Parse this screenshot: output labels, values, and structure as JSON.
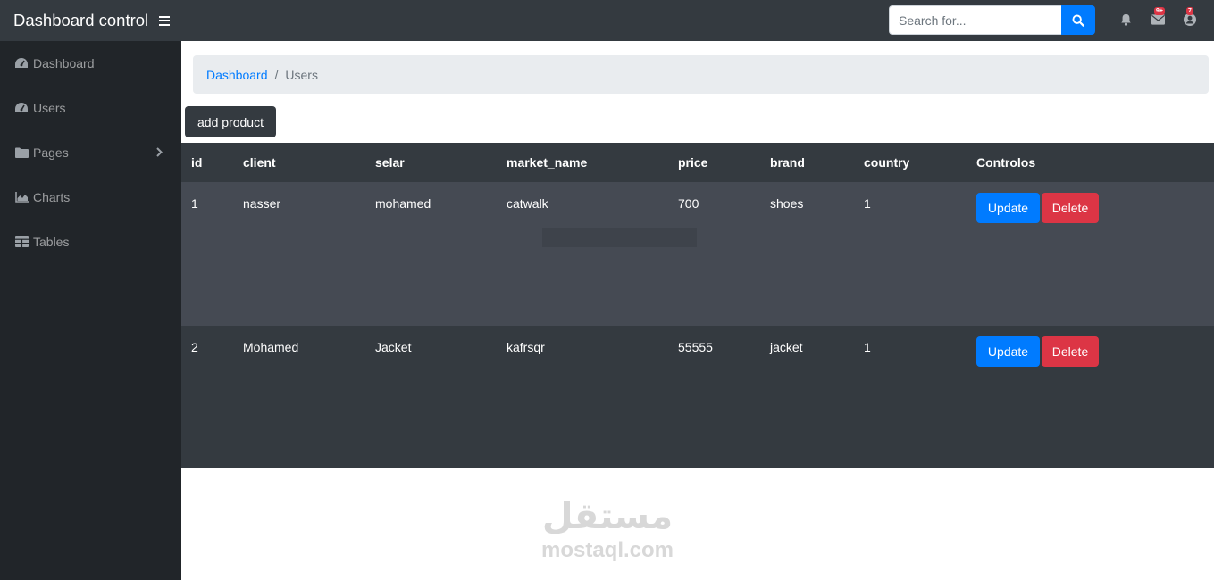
{
  "app": {
    "brand": "Dashboard control",
    "search": {
      "placeholder": "Search for..."
    },
    "badges": {
      "messages": "9+",
      "user": "7"
    }
  },
  "sidebar": {
    "items": [
      {
        "label": "Dashboard",
        "icon": "tachometer-icon"
      },
      {
        "label": "Users",
        "icon": "tachometer-icon"
      },
      {
        "label": "Pages",
        "icon": "folder-icon",
        "has_submenu": true
      },
      {
        "label": "Charts",
        "icon": "area-chart-icon"
      },
      {
        "label": "Tables",
        "icon": "table-icon"
      }
    ]
  },
  "breadcrumb": {
    "link": "Dashboard",
    "separator": "/",
    "current": "Users"
  },
  "toolbar": {
    "add_label": "add product"
  },
  "table": {
    "headers": [
      "id",
      "client",
      "selar",
      "market_name",
      "price",
      "brand",
      "country",
      "Controlos"
    ],
    "rows": [
      {
        "id": "1",
        "client": "nasser",
        "selar": "mohamed",
        "market_name": "catwalk",
        "price": "700",
        "brand": "shoes",
        "country": "1"
      },
      {
        "id": "2",
        "client": "Mohamed",
        "selar": "Jacket",
        "market_name": "kafrsqr",
        "price": "55555",
        "brand": "jacket",
        "country": "1"
      }
    ],
    "update_label": "Update",
    "delete_label": "Delete"
  },
  "watermark": {
    "arabic": "مستقل",
    "latin": "mostaql.com"
  },
  "colors": {
    "navbar": "#343a40",
    "sidebar": "#212529",
    "primary": "#007bff",
    "danger": "#dc3545",
    "row_odd": "#454a53",
    "row_even": "#343a40"
  }
}
